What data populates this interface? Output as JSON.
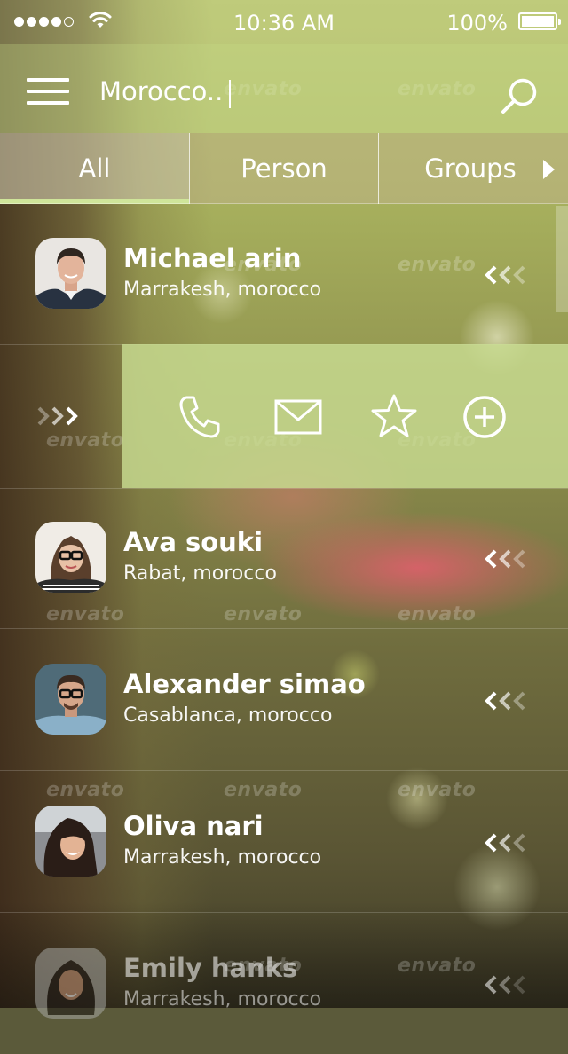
{
  "status_bar": {
    "time": "10:36 AM",
    "battery_percent": "100%",
    "signal_bars_filled": 4,
    "signal_bars_total": 5
  },
  "nav": {
    "menu_icon": "hamburger-icon",
    "search_value": "Morocco..",
    "search_icon": "search-icon"
  },
  "tabs": [
    {
      "label": "All",
      "active": true
    },
    {
      "label": "Person",
      "active": false
    },
    {
      "label": "Groups",
      "active": false
    }
  ],
  "contacts": [
    {
      "name": "Michael arin",
      "city": "Marrakesh, morocco",
      "avatar": "man-short-hair"
    },
    {
      "name": "Ava souki",
      "city": "Rabat, morocco",
      "avatar": "woman-glasses"
    },
    {
      "name": "Alexander simao",
      "city": "Casablanca, morocco",
      "avatar": "man-glasses"
    },
    {
      "name": "Oliva nari",
      "city": "Marrakesh, morocco",
      "avatar": "woman-long-hair"
    },
    {
      "name": "Emily hanks",
      "city": "Marrakesh, morocco",
      "avatar": "woman-curly-hair"
    }
  ],
  "swipe_actions": [
    "phone-icon",
    "mail-icon",
    "star-icon",
    "add-icon"
  ],
  "watermark": "envato",
  "colors": {
    "accent": "#cfe59a",
    "panel": "#c8dc91"
  }
}
